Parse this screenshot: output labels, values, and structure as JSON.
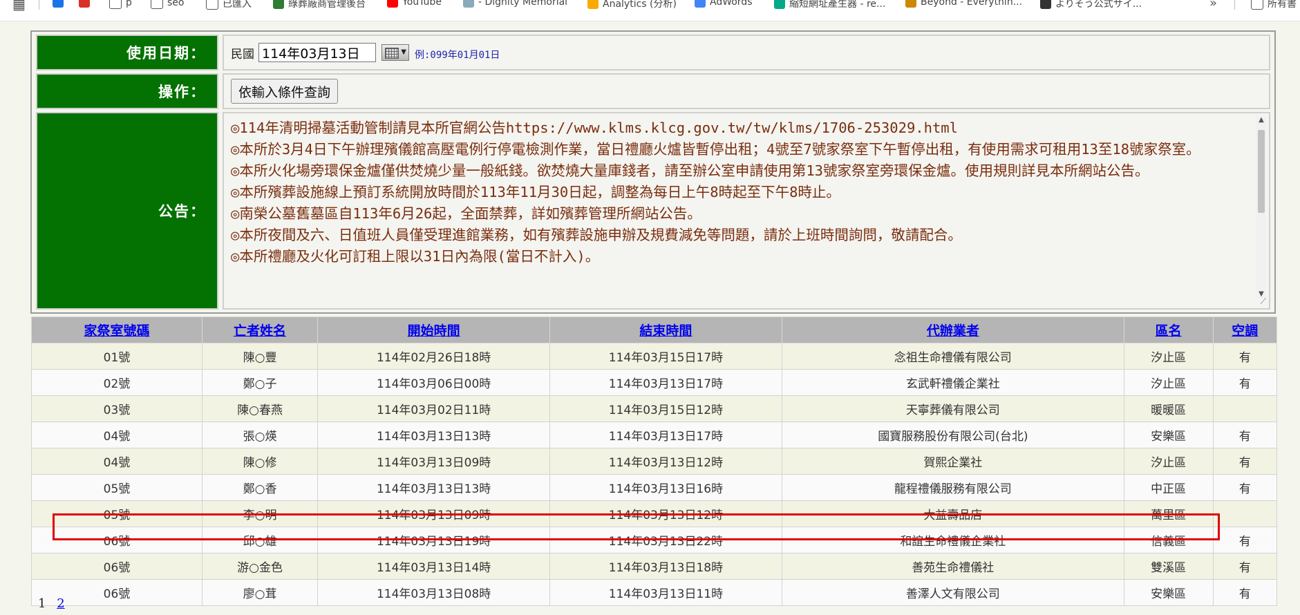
{
  "bookmarks": [
    {
      "label": "",
      "icon": "bookmark-icon-blue",
      "color": "#1a73e8"
    },
    {
      "label": "",
      "icon": "gmail-icon",
      "color": "#d93025"
    },
    {
      "label": "p",
      "icon": "folder-icon",
      "color": "#ffffff"
    },
    {
      "label": "seo",
      "icon": "folder-icon",
      "color": "#ffffff"
    },
    {
      "label": "已匯入",
      "icon": "folder-icon",
      "color": "#ffffff"
    },
    {
      "label": "綠葬廠商管理後台",
      "icon": "site-icon",
      "color": "#2e7d32"
    },
    {
      "label": "YouTube",
      "icon": "youtube-icon",
      "color": "#ff0000"
    },
    {
      "label": "- Dignity Memorial",
      "icon": "site-icon",
      "color": "#8ab"
    },
    {
      "label": "Analytics (分析)",
      "icon": "analytics-icon",
      "color": "#f9ab00"
    },
    {
      "label": "AdWords",
      "icon": "adwords-icon",
      "color": "#4285f4"
    },
    {
      "label": "縮短網址產生器 - re...",
      "icon": "site-icon",
      "color": "#0a8"
    },
    {
      "label": "Beyond - Everythin...",
      "icon": "site-icon",
      "color": "#c80"
    },
    {
      "label": "よりそう公式サイ...",
      "icon": "site-icon",
      "color": "#333"
    },
    {
      "label": "所有書",
      "icon": "folder-icon",
      "color": "#ffffff"
    }
  ],
  "form": {
    "date_label": "使用日期：",
    "era_label": "民國",
    "date_value": "114年03月13日",
    "date_example": "例:099年01月01日",
    "action_label": "操作：",
    "query_button": "依輸入條件查詢",
    "notice_label": "公告：",
    "notices": [
      "◎114年清明掃墓活動管制請見本所官網公告https://www.klms.klcg.gov.tw/tw/klms/1706-253029.html",
      "◎本所於3月4日下午辦理殯儀館高壓電例行停電檢測作業，當日禮廳火爐皆暫停出租；4號至7號家祭室下午暫停出租，有使用需求可租用13至18號家祭室。",
      "◎本所火化場旁環保金爐僅供焚燒少量一般紙錢。欲焚燒大量庫錢者，請至辦公室申請使用第13號家祭室旁環保金爐。使用規則詳見本所網站公告。",
      "◎本所殯葬設施線上預訂系統開放時間於113年11月30日起，調整為每日上午8時起至下午8時止。",
      "◎南榮公墓舊墓區自113年6月26起，全面禁葬，詳如殯葬管理所網站公告。",
      "◎本所夜間及六、日值班人員僅受理進館業務，如有殯葬設施申辦及規費減免等問題，請於上班時間詢問，敬請配合。",
      "◎本所禮廳及火化可訂租上限以31日內為限(當日不計入)。"
    ]
  },
  "table": {
    "headers": [
      "家祭室號碼",
      "亡者姓名",
      "開始時間",
      "結束時間",
      "代辦業者",
      "區名",
      "空調"
    ],
    "rows": [
      [
        "01號",
        "陳○豐",
        "114年02月26日18時",
        "114年03月15日17時",
        "念祖生命禮儀有限公司",
        "汐止區",
        "有"
      ],
      [
        "02號",
        "鄭○子",
        "114年03月06日00時",
        "114年03月13日17時",
        "玄武軒禮儀企業社",
        "汐止區",
        "有"
      ],
      [
        "03號",
        "陳○春燕",
        "114年03月02日11時",
        "114年03月15日12時",
        "天寧葬儀有限公司",
        "暖暖區",
        ""
      ],
      [
        "04號",
        "張○煐",
        "114年03月13日13時",
        "114年03月13日17時",
        "國寶服務股份有限公司(台北)",
        "安樂區",
        "有"
      ],
      [
        "04號",
        "陳○修",
        "114年03月13日09時",
        "114年03月13日12時",
        "賀熙企業社",
        "汐止區",
        "有"
      ],
      [
        "05號",
        "鄭○香",
        "114年03月13日13時",
        "114年03月13日16時",
        "龍程禮儀服務有限公司",
        "中正區",
        "有"
      ],
      [
        "05號",
        "李○明",
        "114年03月13日09時",
        "114年03月13日12時",
        "大益壽品店",
        "萬里區",
        ""
      ],
      [
        "06號",
        "邱○雄",
        "114年03月13日19時",
        "114年03月13日22時",
        "和誼生命禮儀企業社",
        "信義區",
        "有"
      ],
      [
        "06號",
        "游○金色",
        "114年03月13日14時",
        "114年03月13日18時",
        "善苑生命禮儀社",
        "雙溪區",
        "有"
      ],
      [
        "06號",
        "廖○茸",
        "114年03月13日08時",
        "114年03月13日11時",
        "善澤人文有限公司",
        "安樂區",
        "有"
      ]
    ],
    "highlighted_row_index": 7,
    "highlight_color": "#e00000"
  },
  "pager": {
    "current": "1",
    "next": "2"
  },
  "colors": {
    "label_bg": "#037203",
    "header_bg": "#b5b5b5",
    "notice_text": "#7a2e0e",
    "link": "#0000ee"
  }
}
